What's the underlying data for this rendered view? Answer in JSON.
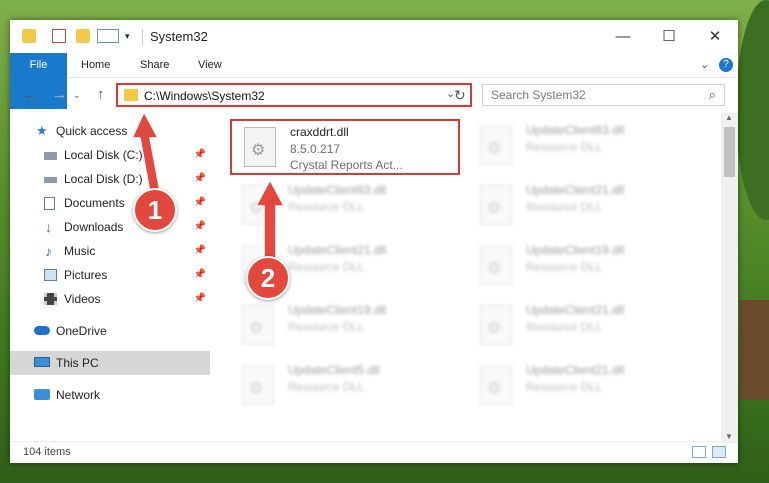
{
  "window": {
    "title": "System32",
    "controls": {
      "minimize": "—",
      "maximize": "☐",
      "close": "✕"
    }
  },
  "ribbon": {
    "tabs": [
      {
        "label": "File"
      },
      {
        "label": "Home"
      },
      {
        "label": "Share"
      },
      {
        "label": "View"
      }
    ]
  },
  "address": {
    "path": "C:\\Windows\\System32",
    "search_placeholder": "Search System32"
  },
  "sidebar": {
    "items": [
      {
        "label": "Quick access",
        "icon": "star-icon"
      },
      {
        "label": "Local Disk (C:)",
        "icon": "drive-icon",
        "pinned": true
      },
      {
        "label": "Local Disk (D:)",
        "icon": "drive-icon",
        "pinned": true
      },
      {
        "label": "Documents",
        "icon": "document-icon",
        "pinned": true
      },
      {
        "label": "Downloads",
        "icon": "download-icon",
        "pinned": true
      },
      {
        "label": "Music",
        "icon": "music-icon",
        "pinned": true
      },
      {
        "label": "Pictures",
        "icon": "picture-icon",
        "pinned": true
      },
      {
        "label": "Videos",
        "icon": "video-icon",
        "pinned": true
      },
      {
        "label": "OneDrive",
        "icon": "cloud-icon"
      },
      {
        "label": "This PC",
        "icon": "computer-icon",
        "selected": true
      },
      {
        "label": "Network",
        "icon": "network-icon"
      }
    ]
  },
  "files": {
    "selected": {
      "name": "craxddrt.dll",
      "version": "8.5.0.217",
      "description": "Crystal Reports Act..."
    },
    "others": [
      {
        "name": "UpdateClient63.dll",
        "desc": "Resource DLL"
      },
      {
        "name": "UpdateClient63.dll",
        "desc": "Resource DLL"
      },
      {
        "name": "UpdateClient21.dll",
        "desc": "Resource DLL"
      },
      {
        "name": "UpdateClient21.dll",
        "desc": "Resource DLL"
      },
      {
        "name": "UpdateClient19.dll",
        "desc": "Resource DLL"
      },
      {
        "name": "UpdateClient19.dll",
        "desc": "Resource DLL"
      },
      {
        "name": "UpdateClient21.dll",
        "desc": "Resource DLL"
      },
      {
        "name": "UpdateClient5.dll",
        "desc": "Resource DLL"
      },
      {
        "name": "UpdateClient21.dll",
        "desc": "Resource DLL"
      }
    ]
  },
  "status": {
    "items_count": "104 items"
  },
  "annotations": {
    "step1": "1",
    "step2": "2",
    "accent": "#d93838"
  }
}
